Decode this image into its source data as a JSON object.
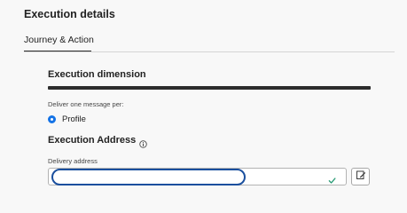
{
  "header": {
    "title": "Execution details"
  },
  "tabs": [
    {
      "label": "Journey & Action",
      "selected": true
    }
  ],
  "execution_dimension": {
    "heading": "Execution dimension",
    "deliver_label": "Deliver one message per:",
    "radio_option": {
      "label": "Profile",
      "selected": true
    }
  },
  "execution_address": {
    "heading": "Execution Address",
    "field_label": "Delivery address",
    "value": "",
    "valid": true
  },
  "colors": {
    "accent": "#1473e6",
    "focus": "#1a4f9e",
    "valid": "#2d9d78"
  },
  "icons": {
    "info": "info-icon",
    "check": "checkmark-icon",
    "edit": "edit-icon"
  }
}
